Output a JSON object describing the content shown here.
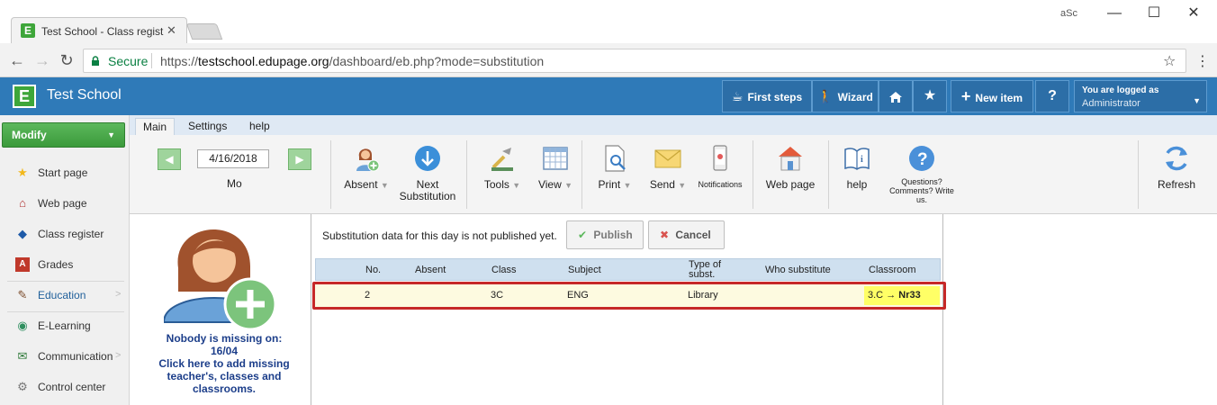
{
  "browser": {
    "tab_title": "Test School - Class regist",
    "tab_favicon": "E",
    "window_user": "aSc",
    "secure_label": "Secure",
    "url_scheme": "https://",
    "url_host": "testschool.edupage.org",
    "url_path": "/dashboard/eb.php?mode=substitution"
  },
  "header": {
    "logo": "E",
    "school_name": "Test School",
    "first_steps": "First steps",
    "wizard": "Wizard",
    "new_item": "New item",
    "help": "?",
    "logged_as": "You are logged as",
    "user": "Administrator"
  },
  "sidebar": {
    "modify": "Modify",
    "items": [
      {
        "label": "Start page",
        "icon": "star-icon",
        "arrow": ""
      },
      {
        "label": "Web page",
        "icon": "web-page-icon",
        "arrow": ""
      },
      {
        "label": "Class register",
        "icon": "class-register-icon",
        "arrow": ""
      },
      {
        "label": "Grades",
        "icon": "grades-icon",
        "arrow": ""
      },
      {
        "label": "Education",
        "icon": "education-icon",
        "arrow": ">"
      },
      {
        "label": "E-Learning",
        "icon": "e-learning-icon",
        "arrow": ""
      },
      {
        "label": "Communication",
        "icon": "communication-icon",
        "arrow": ">"
      },
      {
        "label": "Control center",
        "icon": "control-center-icon",
        "arrow": ""
      }
    ]
  },
  "ribbon": {
    "tabs": [
      "Main",
      "Settings",
      "help"
    ],
    "date": "4/16/2018",
    "day": "Mo",
    "absent": "Absent",
    "next_sub_1": "Next",
    "next_sub_2": "Substitution",
    "tools": "Tools",
    "view": "View",
    "print": "Print",
    "send": "Send",
    "notifications": "Notifications",
    "web_page": "Web page",
    "help": "help",
    "questions_1": "Questions?",
    "questions_2": "Comments? Write",
    "questions_3": "us.",
    "refresh": "Refresh"
  },
  "content": {
    "nobody_1": "Nobody is missing on:",
    "nobody_2": "16/04",
    "nobody_3": "Click here to add missing",
    "nobody_4": "teacher's, classes and",
    "nobody_5": "classrooms.",
    "notice": "Substitution data for this day is not published yet.",
    "publish": "Publish",
    "cancel": "Cancel",
    "columns": {
      "no": "No.",
      "absent": "Absent",
      "class": "Class",
      "subject": "Subject",
      "type_1": "Type of",
      "type_2": "subst.",
      "who": "Who substitute",
      "classroom": "Classroom"
    },
    "row": {
      "no": "2",
      "absent": "",
      "class": "3C",
      "subject": "ENG",
      "type": "Library",
      "who": "",
      "room_from": "3.C",
      "room_arrow": "→",
      "room_to": "Nr33"
    }
  },
  "colors": {
    "header_blue": "#2f7ab8",
    "modify_green": "#3b9a3b",
    "highlight_red": "#c62828",
    "row_yellow": "#fdfae0",
    "classroom_yellow": "#ffff66"
  }
}
